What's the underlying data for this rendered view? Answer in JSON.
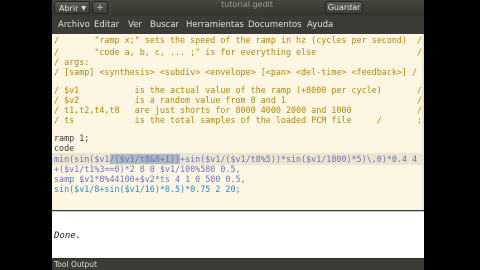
{
  "titlebar": {
    "open_label": "Abrir",
    "new_icon": "new-document-icon",
    "title": "tutorial.gedit",
    "save_label": "Guardar"
  },
  "menu": [
    "Archivo",
    "Editar",
    "Ver",
    "Buscar",
    "Herramientas",
    "Documentos",
    "Ayuda"
  ],
  "editor": {
    "lines": [
      "/       \"ramp x;\" sets the speed of the ramp in hz (cycles per second)  /",
      "/       \"code a, b, c, ... ;\" is for everything else                    /",
      "/ args:                                                                  /",
      "/ [samp] <synthesis> <subdiv> <envelope> [<pan> <del-time> <feedback>] /",
      "",
      "/ $v1           is the actual value of the ramp (+8000 per cycle)       /",
      "/ $v2           is a random value from 0 and 1                          /",
      "/ t1,t2,t4,t8   are just shorts for 8000 4000 2000 and 1000             /",
      "/ ts            is the total samples of the loaded PCM file     /       ;",
      "",
      "ramp 1;",
      "code",
      "min(sin($v1/($v1/t8&8+1))+sin($v1/($v1/t8%5))*sin($v1/1800)*5)\\,0)*0.4 4",
      "+($v1/t1%3==0)*2 8 0 $v1/100%580 0.5,",
      "samp $v1*8%44100+$v2*ts 4 1 0 500 0.5,",
      "sin($v1/8+sin($v1/16)*0.5)*0.75 2 20;"
    ]
  },
  "output": {
    "status_text": "Done.",
    "tab_label": "Tool Output"
  }
}
